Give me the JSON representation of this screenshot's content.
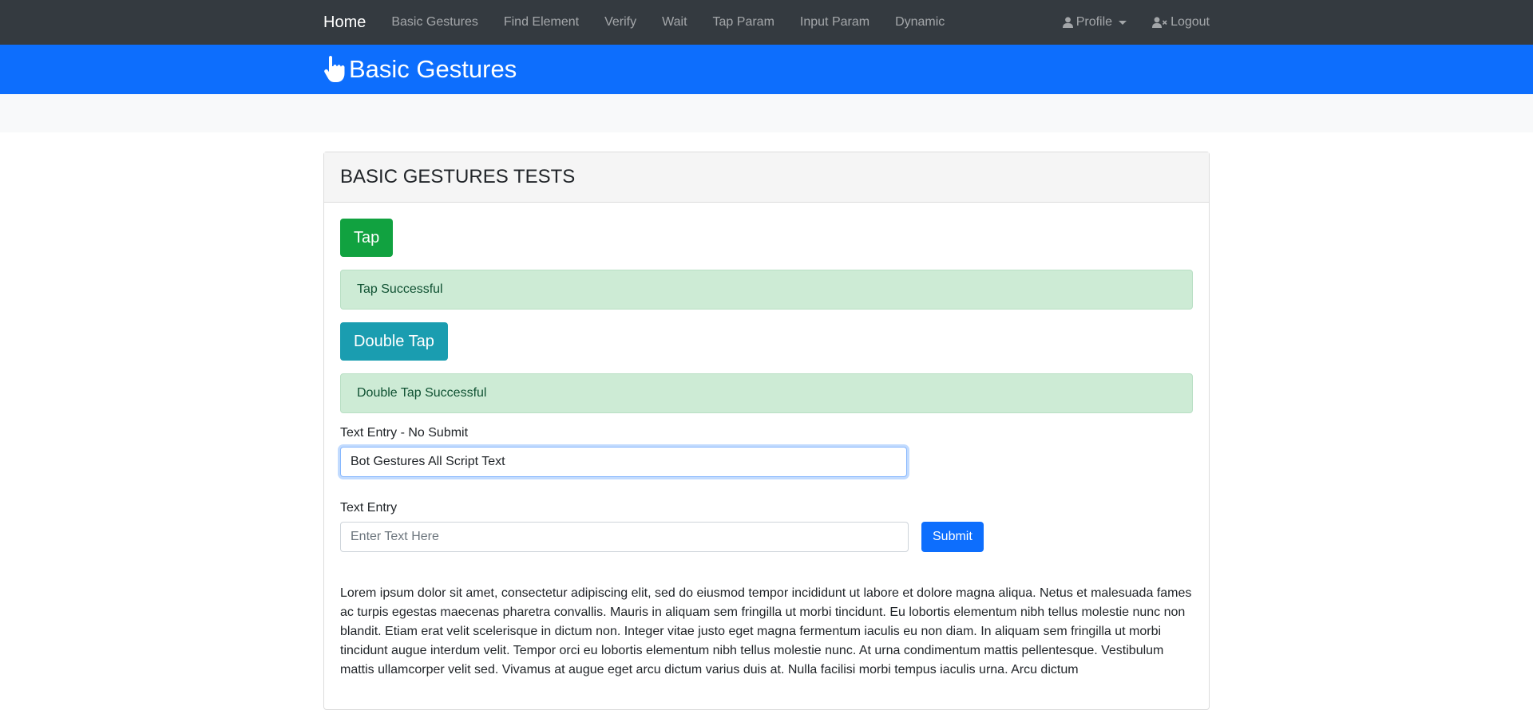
{
  "navbar": {
    "brand": "Home",
    "links": [
      "Basic Gestures",
      "Find Element",
      "Verify",
      "Wait",
      "Tap Param",
      "Input Param",
      "Dynamic"
    ],
    "profile_label": "Profile",
    "logout_label": "Logout"
  },
  "header": {
    "title": "Basic Gestures",
    "icon": "hand-pointer-icon"
  },
  "card": {
    "title": "BASIC GESTURES TESTS",
    "tap_button": "Tap",
    "tap_alert": "Tap Successful",
    "double_tap_button": "Double Tap",
    "double_tap_alert": "Double Tap Successful",
    "text_entry_no_submit": {
      "label": "Text Entry - No Submit",
      "value": "Bot Gestures All Script Text"
    },
    "text_entry": {
      "label": "Text Entry",
      "placeholder": "Enter Text Here",
      "submit_label": "Submit"
    },
    "paragraph": "Lorem ipsum dolor sit amet, consectetur adipiscing elit, sed do eiusmod tempor incididunt ut labore et dolore magna aliqua. Netus et malesuada fames ac turpis egestas maecenas pharetra convallis. Mauris in aliquam sem fringilla ut morbi tincidunt. Eu lobortis elementum nibh tellus molestie nunc non blandit. Etiam erat velit scelerisque in dictum non. Integer vitae justo eget magna fermentum iaculis eu non diam. In aliquam sem fringilla ut morbi tincidunt augue interdum velit. Tempor orci eu lobortis elementum nibh tellus molestie nunc. At urna condimentum mattis pellentesque. Vestibulum mattis ullamcorper velit sed. Vivamus at augue eget arcu dictum varius duis at. Nulla facilisi morbi tempus iaculis urna. Arcu dictum"
  },
  "colors": {
    "navbar_bg": "#343a40",
    "header_bg": "#0d6efd",
    "success_button": "#11a240",
    "info_button": "#1a9db0",
    "primary_button": "#0d6efd",
    "alert_bg": "#cdebd5"
  }
}
